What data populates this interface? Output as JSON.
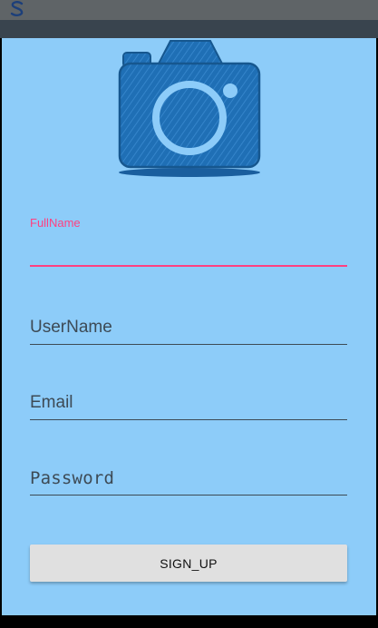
{
  "status_bar": {
    "icon": "s-notification-icon"
  },
  "form": {
    "fullname": {
      "label": "FullName",
      "value": ""
    },
    "username": {
      "placeholder": "UserName"
    },
    "email": {
      "placeholder": "Email"
    },
    "password": {
      "placeholder": "Password"
    }
  },
  "signup_button": {
    "label": "SIGN_UP"
  },
  "colors": {
    "background": "#8dccf9",
    "accent": "#ff4081",
    "camera_blue": "#1f6fb5",
    "button": "#e0e0e0"
  }
}
